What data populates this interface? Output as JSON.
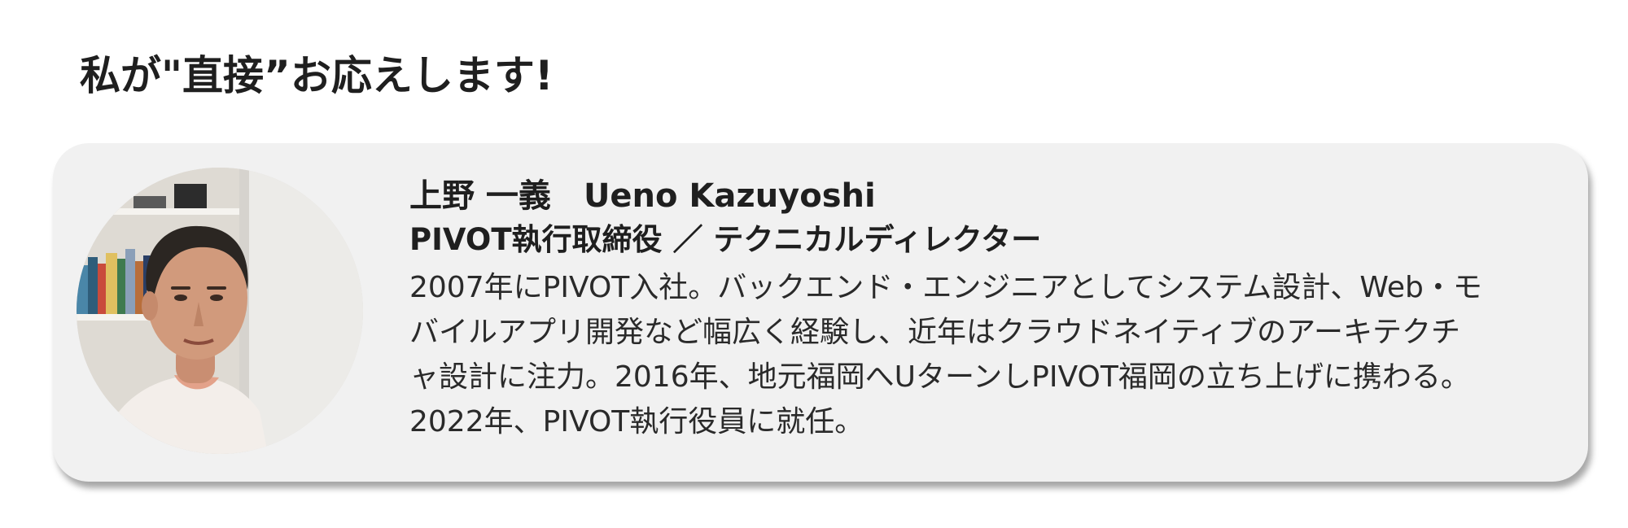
{
  "heading": "私が\"直接”お応えします!",
  "profile": {
    "name_ja": "上野 一義",
    "name_en": "Ueno Kazuyoshi",
    "title": "PIVOT執行取締役 ／ テクニカルディレクター",
    "bio": "2007年にPIVOT入社。バックエンド・エンジニアとしてシステム設計、Web・モバイルアプリ開発など幅広く経験し、近年はクラウドネイティブのアーキテクチャ設計に注力。2016年、地元福岡へUターンしPIVOT福岡の立ち上げに携わる。2022年、PIVOT執行役員に就任。"
  },
  "colors": {
    "card_background": "#f1f1f1",
    "text": "#1f1f1f",
    "page_background": "#ffffff"
  }
}
